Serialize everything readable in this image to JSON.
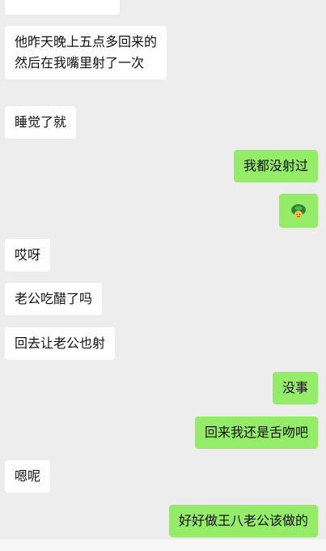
{
  "messages": [
    {
      "side": "left",
      "text": "他昨天晚上五点多回来的 然后在我嘴里射了一次"
    },
    {
      "side": "left",
      "text": "睡觉了就"
    },
    {
      "side": "right",
      "text": "我都没射过"
    },
    {
      "side": "right",
      "emoji": "turtle-emoji"
    },
    {
      "side": "left",
      "text": "哎呀"
    },
    {
      "side": "left",
      "text": "老公吃醋了吗"
    },
    {
      "side": "left",
      "text": "回去让老公也射"
    },
    {
      "side": "right",
      "text": "没事"
    },
    {
      "side": "right",
      "text": "回来我还是舌吻吧"
    },
    {
      "side": "left",
      "text": "嗯呢"
    },
    {
      "side": "right",
      "text": "好好做王八老公该做的"
    }
  ],
  "colors": {
    "background": "#EDEDED",
    "incoming_bubble": "#FFFFFF",
    "outgoing_bubble": "#95EC69",
    "text": "#111111"
  }
}
